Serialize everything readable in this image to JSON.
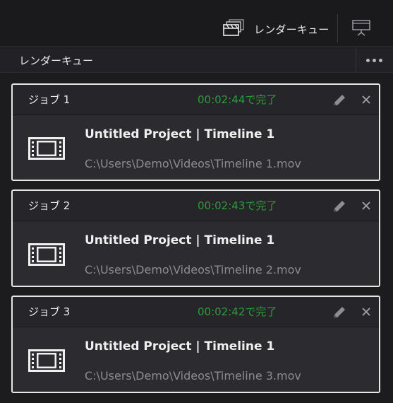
{
  "topbar": {
    "label": "レンダーキュー",
    "icon": "render-queue-clapper-icon",
    "panel_icon": "presentation-screen-icon"
  },
  "panel": {
    "title": "レンダーキュー",
    "menu_icon": "more-options-icon"
  },
  "jobs": [
    {
      "name": "ジョブ 1",
      "status": "00:02:44で完了",
      "title": "Untitled Project | Timeline 1",
      "path": "C:\\Users\\Demo\\Videos\\Timeline 1.mov"
    },
    {
      "name": "ジョブ 2",
      "status": "00:02:43で完了",
      "title": "Untitled Project | Timeline 1",
      "path": "C:\\Users\\Demo\\Videos\\Timeline 2.mov"
    },
    {
      "name": "ジョブ 3",
      "status": "00:02:42で完了",
      "title": "Untitled Project | Timeline 1",
      "path": "C:\\Users\\Demo\\Videos\\Timeline 3.mov"
    }
  ],
  "colors": {
    "status_done": "#2f9a3a",
    "selection_border": "#e6e6e6",
    "background": "#1c1c1f"
  }
}
